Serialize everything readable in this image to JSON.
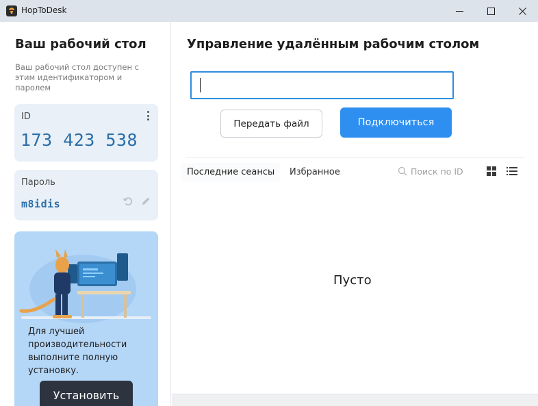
{
  "window": {
    "title": "HopToDesk"
  },
  "sidebar": {
    "title": "Ваш рабочий стол",
    "description": "Ваш рабочий стол доступен с этим идентификатором и паролем",
    "id_card": {
      "label": "ID",
      "value": "173 423 538"
    },
    "password_card": {
      "label": "Пароль",
      "value": "m8idis"
    },
    "promo": {
      "text": "Для лучшей производительности выполните полную установку.",
      "button_label": "Установить"
    }
  },
  "main": {
    "title": "Управление удалённым рабочим столом",
    "remote_id_input": {
      "value": "",
      "placeholder": ""
    },
    "transfer_button_label": "Передать файл",
    "connect_button_label": "Подключиться",
    "tabs": [
      {
        "label": "Последние сеансы",
        "active": true
      },
      {
        "label": "Избранное",
        "active": false
      }
    ],
    "search": {
      "placeholder": "Поиск по ID"
    },
    "empty_label": "Пусто"
  },
  "colors": {
    "accent": "#2e8ff0",
    "id_text": "#2b6ea8",
    "promo_bg": "#b4d6f7",
    "install_button_bg": "#2d3440",
    "titlebar_bg": "#dde3ea"
  },
  "icons": [
    "app-logo-icon",
    "minimize-icon",
    "maximize-icon",
    "close-icon",
    "more-options-icon",
    "refresh-password-icon",
    "edit-password-icon",
    "search-icon",
    "grid-view-icon",
    "list-view-icon"
  ]
}
